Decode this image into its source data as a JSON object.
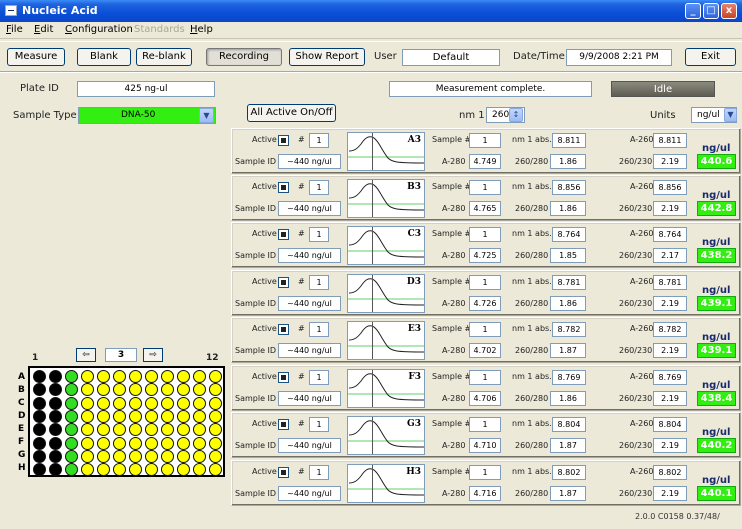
{
  "window": {
    "title": "Nucleic Acid",
    "buttons": [
      "_",
      "□",
      "x"
    ]
  },
  "menu": [
    {
      "label": "File",
      "disabled": false
    },
    {
      "label": "Edit",
      "disabled": false
    },
    {
      "label": "Configuration",
      "disabled": false
    },
    {
      "label": "Standards",
      "disabled": true
    },
    {
      "label": "Help",
      "disabled": false
    }
  ],
  "toolbar": {
    "measure": "Measure",
    "blank": "Blank",
    "reblank": "Re-blank",
    "recording": "Recording",
    "show_report": "Show Report",
    "user_label": "User",
    "user_value": "Default",
    "datetime_label": "Date/Time",
    "datetime_value": "9/9/2008 2:21 PM",
    "exit": "Exit"
  },
  "info": {
    "plate_label": "Plate ID",
    "plate_value": "425 ng-ul",
    "message": "Measurement complete.",
    "status": "Idle",
    "sample_type_label": "Sample Type",
    "sample_type_value": "DNA-50",
    "all_active": "All Active On/Off",
    "nm1_label": "nm 1",
    "nm1_value": "260",
    "units_label": "Units",
    "units_value": "ng/ul"
  },
  "panel_labels": {
    "active": "Active",
    "num": "#",
    "sample_id": "Sample ID",
    "sample_num": "Sample #",
    "nm1abs": "nm 1 abs.",
    "a260": "A-260",
    "a280": "A-280",
    "r260_280": "260/280",
    "r260_230": "260/230",
    "unit": "ng/ul"
  },
  "samples": [
    {
      "well": "A3",
      "num": "1",
      "sample_id": "~440 ng/ul",
      "sample_num": "1",
      "nm1abs": "8.811",
      "a260": "8.811",
      "a280": "4.749",
      "r260_280": "1.86",
      "r260_230": "2.19",
      "conc": "440.6"
    },
    {
      "well": "B3",
      "num": "1",
      "sample_id": "~440 ng/ul",
      "sample_num": "1",
      "nm1abs": "8.856",
      "a260": "8.856",
      "a280": "4.765",
      "r260_280": "1.86",
      "r260_230": "2.19",
      "conc": "442.8"
    },
    {
      "well": "C3",
      "num": "1",
      "sample_id": "~440 ng/ul",
      "sample_num": "1",
      "nm1abs": "8.764",
      "a260": "8.764",
      "a280": "4.725",
      "r260_280": "1.85",
      "r260_230": "2.17",
      "conc": "438.2"
    },
    {
      "well": "D3",
      "num": "1",
      "sample_id": "~440 ng/ul",
      "sample_num": "1",
      "nm1abs": "8.781",
      "a260": "8.781",
      "a280": "4.726",
      "r260_280": "1.86",
      "r260_230": "2.19",
      "conc": "439.1"
    },
    {
      "well": "E3",
      "num": "1",
      "sample_id": "~440 ng/ul",
      "sample_num": "1",
      "nm1abs": "8.782",
      "a260": "8.782",
      "a280": "4.702",
      "r260_280": "1.87",
      "r260_230": "2.19",
      "conc": "439.1"
    },
    {
      "well": "F3",
      "num": "1",
      "sample_id": "~440 ng/ul",
      "sample_num": "1",
      "nm1abs": "8.769",
      "a260": "8.769",
      "a280": "4.706",
      "r260_280": "1.86",
      "r260_230": "2.19",
      "conc": "438.4"
    },
    {
      "well": "G3",
      "num": "1",
      "sample_id": "~440 ng/ul",
      "sample_num": "1",
      "nm1abs": "8.804",
      "a260": "8.804",
      "a280": "4.710",
      "r260_280": "1.87",
      "r260_230": "2.19",
      "conc": "440.2"
    },
    {
      "well": "H3",
      "num": "1",
      "sample_id": "~440 ng/ul",
      "sample_num": "1",
      "nm1abs": "8.802",
      "a260": "8.802",
      "a280": "4.716",
      "r260_280": "1.87",
      "r260_230": "2.19",
      "conc": "440.1"
    }
  ],
  "plate": {
    "col_start": "1",
    "col_end": "12",
    "page": "3",
    "rows": [
      "A",
      "B",
      "C",
      "D",
      "E",
      "F",
      "G",
      "H"
    ],
    "columns": 12,
    "well_states": [
      "measured",
      "measured",
      "current",
      "pending",
      "pending",
      "pending",
      "pending",
      "pending",
      "pending",
      "pending",
      "pending",
      "pending"
    ],
    "colors": {
      "measured": "#000000",
      "current": "#33dd22",
      "pending": "#ffff00"
    }
  },
  "version": "2.0.0 C0158 0.37/48/"
}
